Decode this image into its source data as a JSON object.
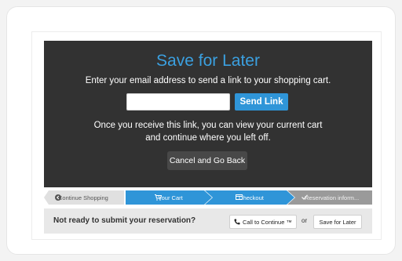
{
  "modal": {
    "title": "Save for Later",
    "subtitle": "Enter your email address to send a link to your shopping cart.",
    "email_value": "",
    "send_label": "Send Link",
    "body_line1": "Once you receive this link, you can view your current cart",
    "body_line2": "and continue where you left off.",
    "cancel_label": "Cancel and Go Back"
  },
  "steps": {
    "continue": {
      "label": "Continue Shopping",
      "icon": "chevron-left-circle-icon"
    },
    "cart": {
      "label": "Your Cart",
      "icon": "cart-icon"
    },
    "checkout": {
      "label": "Checkout",
      "icon": "credit-card-icon"
    },
    "reservation": {
      "label": "Reservation inform...",
      "icon": "check-icon"
    }
  },
  "footer": {
    "question": "Not ready to submit your reservation?",
    "call_label": "Call to Continue ™",
    "or_label": "or",
    "save_label": "Save for Later"
  },
  "colors": {
    "modal_bg": "#323232",
    "accent": "#2f95d8",
    "title": "#3ba0e0",
    "step_active": "#2f95d8",
    "step_inactive": "#e0e0e0",
    "step_disabled": "#9a9a9a",
    "footer_bg": "#e8e8e8"
  }
}
